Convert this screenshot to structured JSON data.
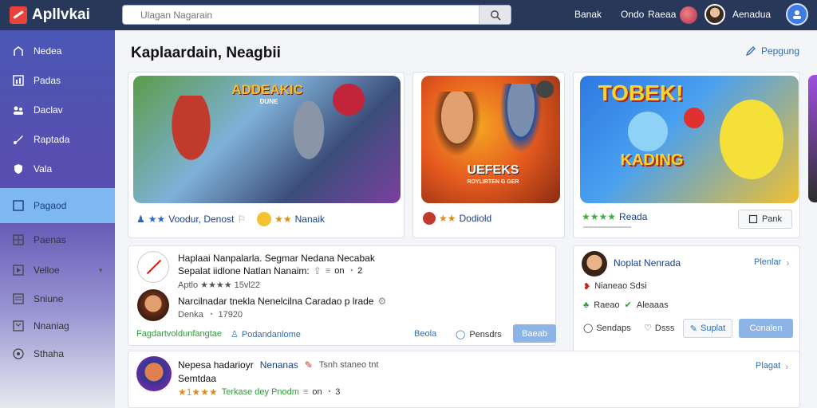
{
  "app": {
    "brand": "Apllvkai",
    "brand_color": "#e8423a",
    "topbar_color": "#27385a"
  },
  "search": {
    "placeholder": "Ulagan Nagarain",
    "icon": "search-icon"
  },
  "topnav": {
    "links": [
      "Banak",
      "Ondo",
      "Raeaa"
    ],
    "user_name": "Aenadua"
  },
  "sidebar": {
    "items": [
      {
        "label": "Nedea",
        "icon": "home-icon"
      },
      {
        "label": "Padas",
        "icon": "chart-icon"
      },
      {
        "label": "Daclav",
        "icon": "group-icon"
      },
      {
        "label": "Raptada",
        "icon": "brush-icon"
      },
      {
        "label": "Vala",
        "icon": "shield-icon"
      },
      {
        "label": "Pagaod",
        "icon": "box-icon"
      },
      {
        "label": "Paenas",
        "icon": "grid-icon"
      },
      {
        "label": "Velloe",
        "icon": "play-icon"
      },
      {
        "label": "Sniune",
        "icon": "monitor-icon"
      },
      {
        "label": "Nnaniag",
        "icon": "book-icon"
      },
      {
        "label": "Sthaha",
        "icon": "help-icon"
      }
    ],
    "active_index": 5
  },
  "main": {
    "title": "Kaplaardain, Neagbii",
    "top_action": "Pepgung",
    "featured": [
      {
        "art_title": "ADDEAKIC",
        "art_subtitle": "DUNE",
        "meta1": "Voodur, Denost",
        "meta2": "Nanaik"
      },
      {
        "art_title": "UEFEKS",
        "art_subtitle": "ROYLIRTEN G GER",
        "meta1": "Dodiold"
      },
      {
        "art_title": "TOBEK!",
        "art_subtitle": "KADING",
        "meta1": "Reada",
        "button": "Pank"
      }
    ],
    "feed": {
      "post1": {
        "title": "Haplaai Nanpalarla. Segmar Nedana Necabak",
        "line2": "Sepalat iidlone Natlan Nanaim:",
        "line2_stats": "on",
        "line2_num": "2",
        "line3": "Aptlo ★★★★ 15vl22",
        "reply": "Narcilnadar tnekla Nenelcilna Caradao p lrade",
        "reply_meta": "Denka",
        "reply_num": "17920",
        "footer_left": "Fagdartvoldunfangtae",
        "footer_mid": "Podandanlome",
        "footer_link": "Beola",
        "footer_comments": "Pensdrs",
        "footer_button": "Baeab"
      },
      "side_card": {
        "name": "Noplat Nenrada",
        "link": "Plenlar",
        "line2": "Nianeao Sdsi",
        "line3_a": "Raeao",
        "line3_b": "Aleaaas",
        "action1": "Sendaps",
        "action2": "Dsss",
        "button_outline": "Suplat",
        "button_blue": "Conalen"
      },
      "post2": {
        "title": "Nepesa hadarioyr",
        "title_accent": "Nenanas",
        "title_tail": "Tsnh staneo tnt",
        "line2": "Semtdaa",
        "line3": "Terkase dey Pnodm",
        "line3_stats": "on",
        "line3_num": "3",
        "link": "Plagat"
      }
    }
  }
}
